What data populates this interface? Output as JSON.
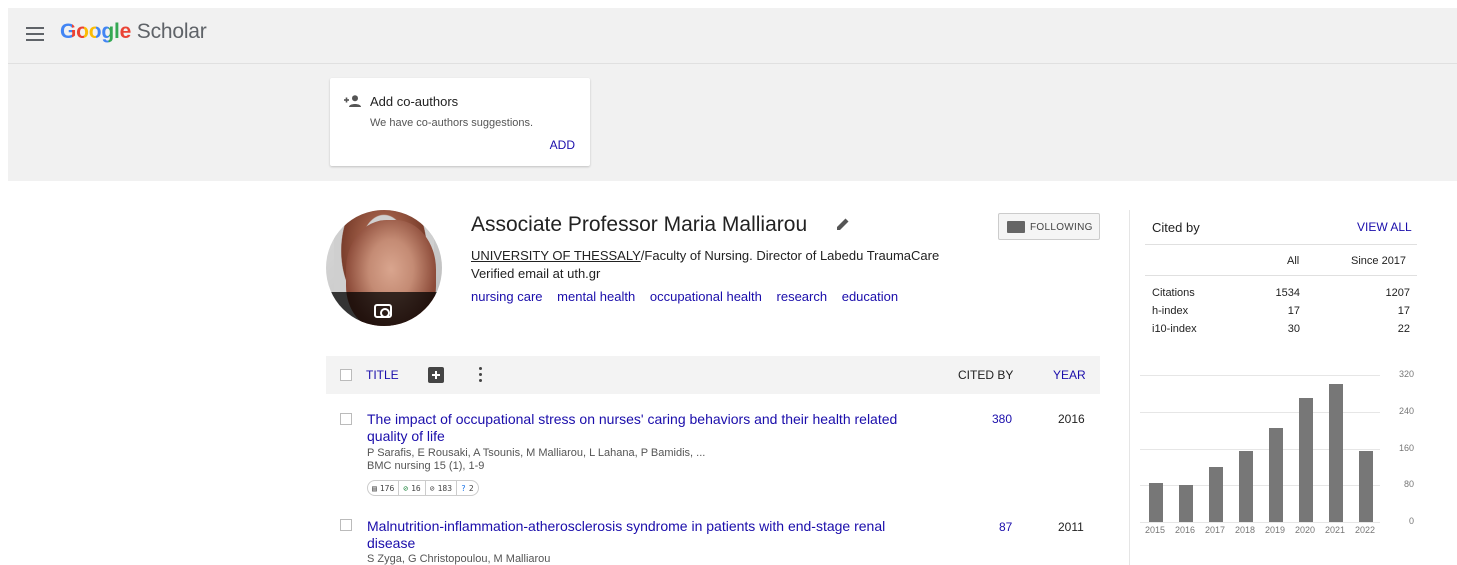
{
  "header": {
    "brand_google": "Google",
    "brand_scholar": "Scholar"
  },
  "coauthors": {
    "title": "Add co-authors",
    "subtitle": "We have co-authors suggestions.",
    "action": "ADD"
  },
  "profile": {
    "name": "Associate Professor Maria Malliarou",
    "affiliation_link": "UNIVERSITY OF THESSALY",
    "affiliation_rest": "/Faculty of Nursing. Director of Labedu TraumaCare",
    "email": "Verified email at uth.gr",
    "interests": [
      "nursing care",
      "mental health",
      "occupational health",
      "research",
      "education"
    ],
    "follow_label": "FOLLOWING"
  },
  "table": {
    "col_title": "TITLE",
    "col_cited": "CITED BY",
    "col_year": "YEAR",
    "rows": [
      {
        "title_line1": "The impact of occupational stress on nurses' caring behaviors and their health related",
        "title_line2": "quality of life",
        "authors": "P Sarafis, E Rousaki, A Tsounis, M Malliarou, L Lahana, P Bamidis, ...",
        "venue": "BMC nursing 15 (1), 1-9",
        "cited": "380",
        "year": "2016",
        "metrics": [
          "176",
          "16",
          "183",
          "2"
        ]
      },
      {
        "title_line1": "Malnutrition-inflammation-atherosclerosis syndrome in patients with end-stage renal",
        "title_line2": "disease",
        "authors": "S Zyga, G Christopoulou, M Malliarou",
        "venue": "",
        "cited": "87",
        "year": "2011"
      }
    ]
  },
  "cited_by": {
    "title": "Cited by",
    "view_all": "VIEW ALL",
    "col_all": "All",
    "col_since": "Since 2017",
    "stats": [
      {
        "label": "Citations",
        "all": "1534",
        "since": "1207"
      },
      {
        "label": "h-index",
        "all": "17",
        "since": "17"
      },
      {
        "label": "i10-index",
        "all": "30",
        "since": "22"
      }
    ]
  },
  "chart_data": {
    "type": "bar",
    "categories": [
      "2015",
      "2016",
      "2017",
      "2018",
      "2019",
      "2020",
      "2021",
      "2022"
    ],
    "values": [
      85,
      80,
      120,
      155,
      205,
      270,
      300,
      155
    ],
    "yticks": [
      "0",
      "80",
      "160",
      "240",
      "320"
    ],
    "ylim": [
      0,
      320
    ],
    "grid": true
  },
  "colors": {
    "link": "#1a0dab",
    "bar": "#777777"
  }
}
